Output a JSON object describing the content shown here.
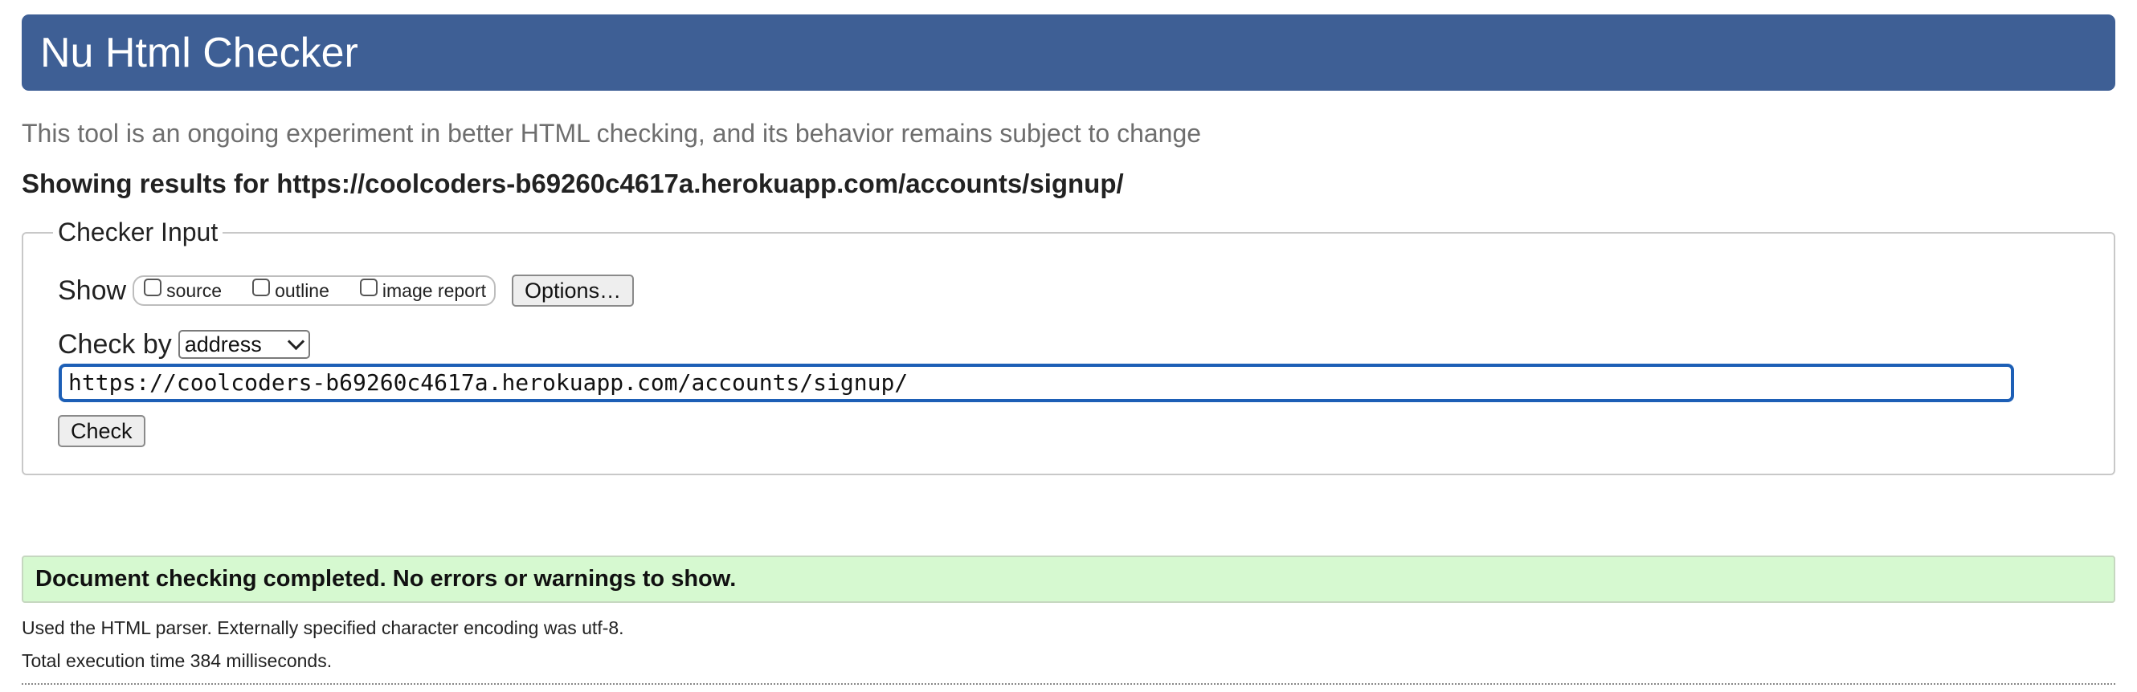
{
  "header": {
    "title": "Nu Html Checker"
  },
  "tagline": "This tool is an ongoing experiment in better HTML checking, and its behavior remains subject to change",
  "results_heading": "Showing results for https://coolcoders-b69260c4617a.herokuapp.com/accounts/signup/",
  "checker_input": {
    "legend": "Checker Input",
    "show_label": "Show",
    "show_options": [
      {
        "label": "source",
        "checked": false
      },
      {
        "label": "outline",
        "checked": false
      },
      {
        "label": "image report",
        "checked": false
      }
    ],
    "options_button": "Options…",
    "check_by_label": "Check by",
    "check_by_selected": "address",
    "url_value": "https://coolcoders-b69260c4617a.herokuapp.com/accounts/signup/",
    "check_button": "Check"
  },
  "result": {
    "success_message": "Document checking completed. No errors or warnings to show.",
    "parser_info": "Used the HTML parser. Externally specified character encoding was utf-8.",
    "execution_time": "Total execution time 384 milliseconds."
  },
  "colors": {
    "header_bg": "#3e5f95",
    "success_bg": "#d6f9d0",
    "input_focus_border": "#1d5fb6"
  }
}
